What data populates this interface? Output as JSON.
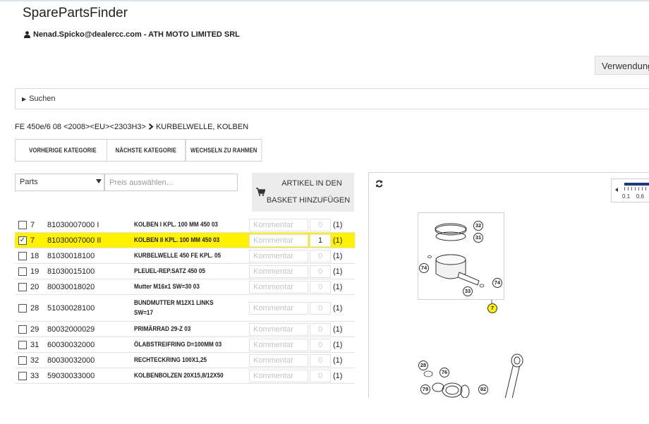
{
  "app": {
    "title": "SparePartsFinder"
  },
  "user": {
    "label": "Nenad.Spicko@dealercc.com - ATH MOTO LIMITED SRL"
  },
  "header": {
    "usage_button": "Verwendung"
  },
  "search": {
    "label": "Suchen"
  },
  "breadcrumb": {
    "model": "FE 450e/6 08 <2008><EU><2303H3>",
    "category": "KURBELWELLE, KOLBEN"
  },
  "nav": {
    "prev": "VORHERIGE KATEGORIE",
    "next": "NÄCHSTE KATEGORIE",
    "frame": "WECHSELN ZU RAHMEN"
  },
  "filters": {
    "parts_select": "Parts",
    "price_placeholder": "Preis auswählen..."
  },
  "basket": {
    "line1": "ARTIKEL IN DEN",
    "line2": "BASKET HINZUFÜGEN"
  },
  "parts": [
    {
      "checked": false,
      "pos": "7",
      "number": "81030007000 I",
      "desc": "KOLBEN I KPL. 100 MM 450 03",
      "comment_placeholder": "Kommentar",
      "qty": "0",
      "avail": "(1)",
      "selected": false
    },
    {
      "checked": true,
      "pos": "7",
      "number": "81030007000 II",
      "desc": "KOLBEN II KPL. 100 MM 450 03",
      "comment_placeholder": "Kommentar",
      "qty": "1",
      "avail": "(1)",
      "selected": true
    },
    {
      "checked": false,
      "pos": "18",
      "number": "81030018100",
      "desc": "KURBELWELLE 450 FE KPL. 05",
      "comment_placeholder": "Kommentar",
      "qty": "0",
      "avail": "(1)",
      "selected": false
    },
    {
      "checked": false,
      "pos": "19",
      "number": "81030015100",
      "desc": "PLEUEL-REP.SATZ 450 05",
      "comment_placeholder": "Kommentar",
      "qty": "0",
      "avail": "(1)",
      "selected": false
    },
    {
      "checked": false,
      "pos": "20",
      "number": "80030018020",
      "desc": "Mutter M16x1 SW=30 03",
      "comment_placeholder": "Kommentar",
      "qty": "0",
      "avail": "(1)",
      "selected": false
    },
    {
      "checked": false,
      "pos": "28",
      "number": "51030028100",
      "desc": "BUNDMUTTER M12X1 LINKS",
      "desc2": "SW=17",
      "comment_placeholder": "Kommentar",
      "qty": "0",
      "avail": "(1)",
      "selected": false
    },
    {
      "checked": false,
      "pos": "29",
      "number": "80032000029",
      "desc": "PRIMÄRRAD 29-Z 03",
      "comment_placeholder": "Kommentar",
      "qty": "0",
      "avail": "(1)",
      "selected": false
    },
    {
      "checked": false,
      "pos": "31",
      "number": "60030032000",
      "desc": "ÖLABSTREIFRING D=100MM 03",
      "comment_placeholder": "Kommentar",
      "qty": "0",
      "avail": "(1)",
      "selected": false
    },
    {
      "checked": false,
      "pos": "32",
      "number": "80030032000",
      "desc": "RECHTECKRING 100X1,25",
      "comment_placeholder": "Kommentar",
      "qty": "0",
      "avail": "(1)",
      "selected": false
    },
    {
      "checked": false,
      "pos": "33",
      "number": "59030033000",
      "desc": "KOLBENBOLZEN 20X15,8/12X50",
      "comment_placeholder": "Kommentar",
      "qty": "0",
      "avail": "(1)",
      "selected": false
    }
  ],
  "diagram": {
    "zoom_min": "0.1",
    "zoom_max": "0.6",
    "callouts": [
      "32",
      "31",
      "74",
      "74",
      "33",
      "7",
      "28",
      "76",
      "79",
      "82"
    ],
    "highlight_color": "#fff100"
  }
}
